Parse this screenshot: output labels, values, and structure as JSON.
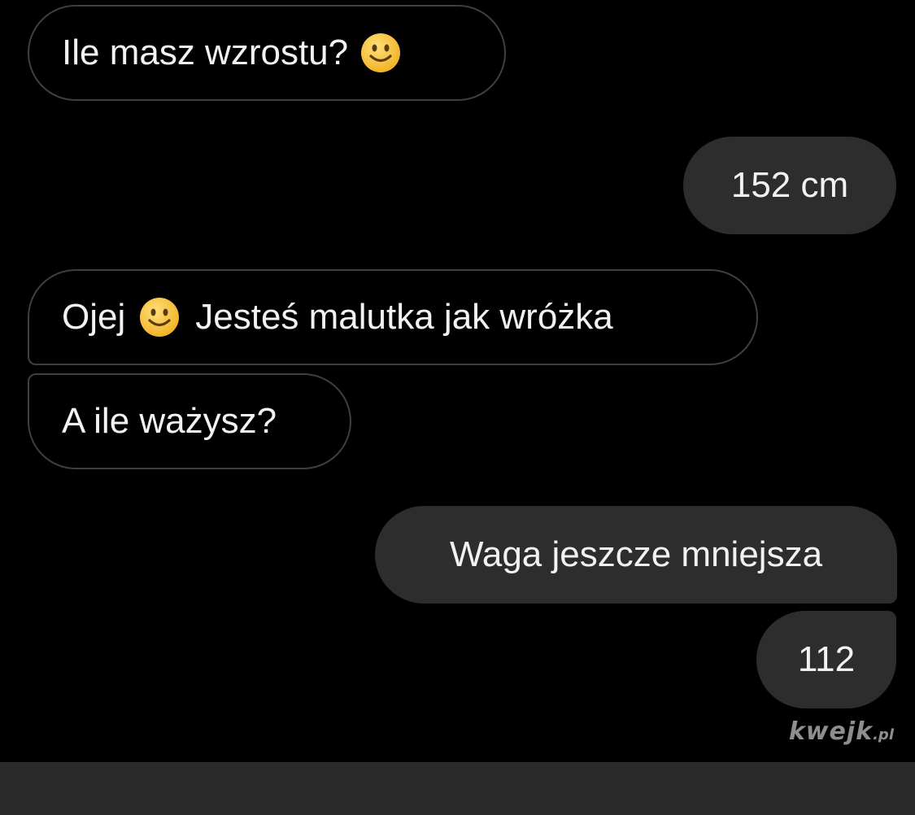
{
  "conversation": {
    "messages": [
      {
        "side": "incoming",
        "text": "Ile masz wzrostu?",
        "emoji": "slightly-smiling-face-icon"
      },
      {
        "side": "outgoing",
        "text": "152 cm"
      },
      {
        "side": "incoming",
        "text_before": "Ojej",
        "emoji": "slightly-smiling-face-icon",
        "text_after": "Jesteś malutka jak wróżka"
      },
      {
        "side": "incoming",
        "text": "A ile ważysz?"
      },
      {
        "side": "outgoing",
        "text": "Waga jeszcze mniejsza"
      },
      {
        "side": "outgoing",
        "text": "112"
      }
    ]
  },
  "watermark": {
    "brand": "kwejk",
    "tld": ".pl"
  },
  "colors": {
    "chat_background": "#000000",
    "incoming_border": "#3f3f3f",
    "outgoing_bubble": "#2d2d2d",
    "text": "#f2f2f2",
    "emoji_face": "#f7c53b",
    "bottom_bar": "#2b2b2b"
  }
}
